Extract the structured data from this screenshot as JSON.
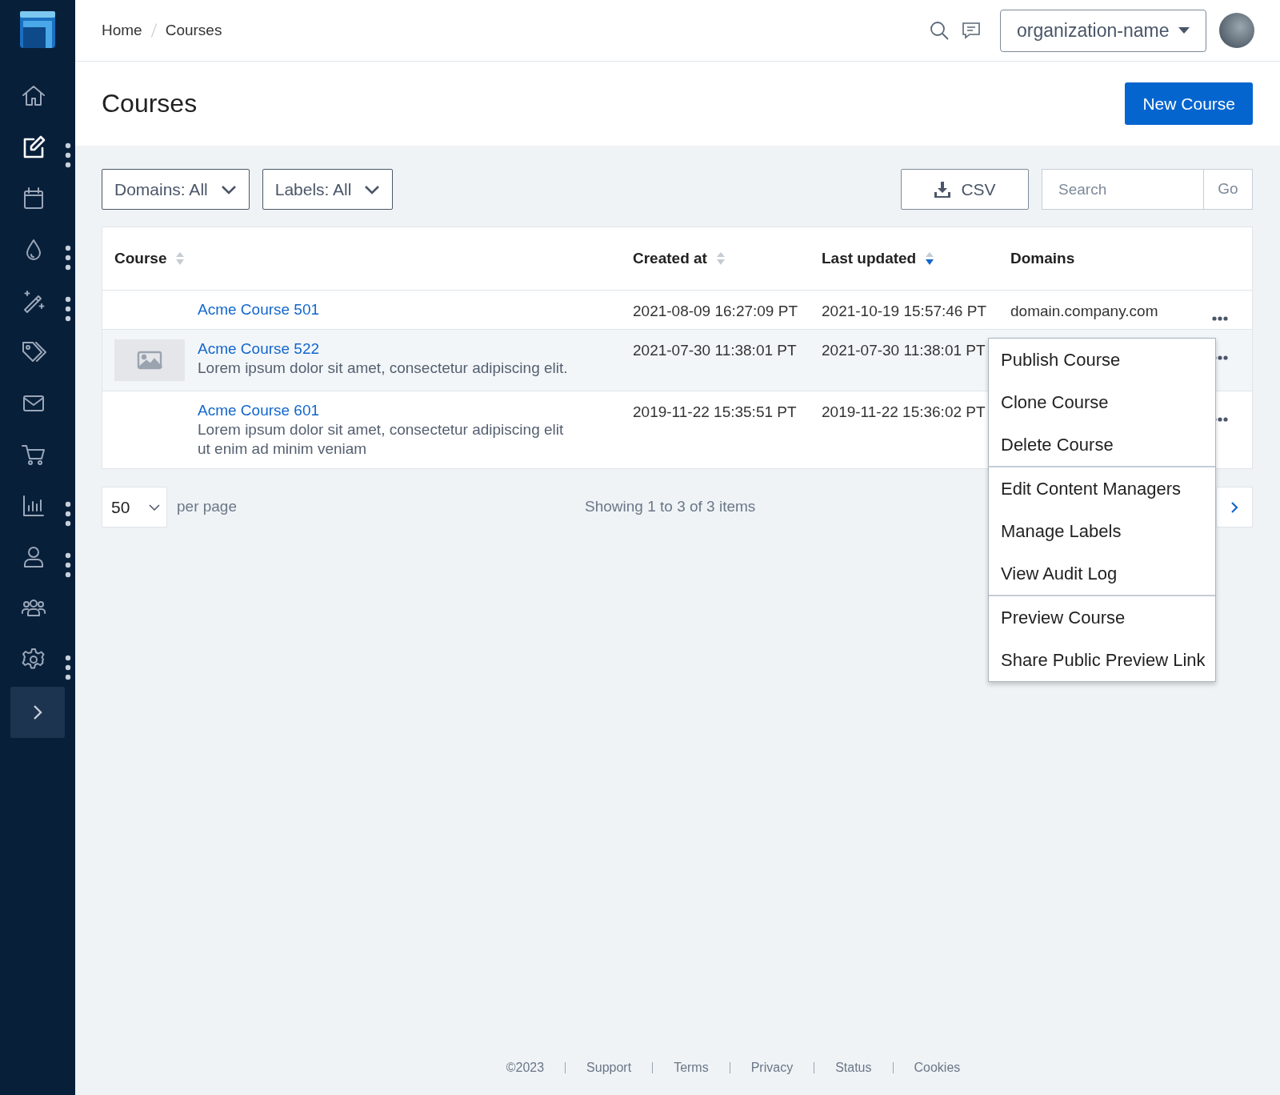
{
  "sidebar": {
    "items": [
      {
        "kind": "home",
        "selected": false,
        "submenu": false
      },
      {
        "kind": "edit",
        "selected": true,
        "submenu": true
      },
      {
        "kind": "calendar",
        "selected": false,
        "submenu": false
      },
      {
        "kind": "drop",
        "selected": false,
        "submenu": true
      },
      {
        "kind": "wand",
        "selected": false,
        "submenu": true
      },
      {
        "kind": "tags",
        "selected": false,
        "submenu": false
      },
      {
        "kind": "mail",
        "selected": false,
        "submenu": false
      },
      {
        "kind": "cart",
        "selected": false,
        "submenu": false
      },
      {
        "kind": "chart",
        "selected": false,
        "submenu": true
      },
      {
        "kind": "user",
        "selected": false,
        "submenu": true
      },
      {
        "kind": "users",
        "selected": false,
        "submenu": false
      },
      {
        "kind": "gear",
        "selected": false,
        "submenu": true
      }
    ]
  },
  "header": {
    "breadcrumb": [
      "Home",
      "Courses"
    ],
    "organization": "organization-name"
  },
  "page": {
    "title": "Courses",
    "new_button": "New Course"
  },
  "filters": [
    {
      "label": "Domains: All"
    },
    {
      "label": "Labels: All"
    }
  ],
  "csv_button": "CSV",
  "search": {
    "placeholder": "Search",
    "go": "Go"
  },
  "table": {
    "columns": [
      {
        "label": "Course",
        "sortable": true,
        "sorted": false
      },
      {
        "label": "Created at",
        "sortable": true,
        "sorted": false
      },
      {
        "label": "Last updated",
        "sortable": true,
        "sorted": true
      },
      {
        "label": "Domains",
        "sortable": false
      }
    ],
    "rows": [
      {
        "title": "Acme Course 501",
        "thumbnail": false,
        "hovered": false,
        "created": "2021-08-09 16:27:09 PT",
        "updated": "2021-10-19 15:57:46 PT",
        "domain": "domain.company.com"
      },
      {
        "title": "Acme Course 522",
        "description": "Lorem ipsum dolor sit amet, consectetur adipiscing elit.",
        "thumbnail": true,
        "hovered": true,
        "created": "2021-07-30 11:38:01 PT",
        "updated": "2021-07-30 11:38:01 PT"
      },
      {
        "title": "Acme Course 601",
        "description": "Lorem ipsum dolor sit amet, consectetur adipiscing elit ut enim ad minim veniam",
        "thumbnail": false,
        "hovered": false,
        "created": "2019-11-22 15:35:51 PT",
        "updated": "2019-11-22 15:36:02 PT"
      }
    ]
  },
  "menu": {
    "groups": [
      [
        "Publish Course",
        "Clone Course",
        "Delete Course"
      ],
      [
        "Edit Content Managers",
        "Manage Labels",
        "View Audit Log"
      ],
      [
        "Preview Course",
        "Share Public Preview Link"
      ]
    ]
  },
  "pagination": {
    "per_page": "50",
    "per_page_label": "per page",
    "summary": "Showing 1 to 3 of 3 items"
  },
  "footer": [
    "©2023",
    "Support",
    "Terms",
    "Privacy",
    "Status",
    "Cookies"
  ]
}
